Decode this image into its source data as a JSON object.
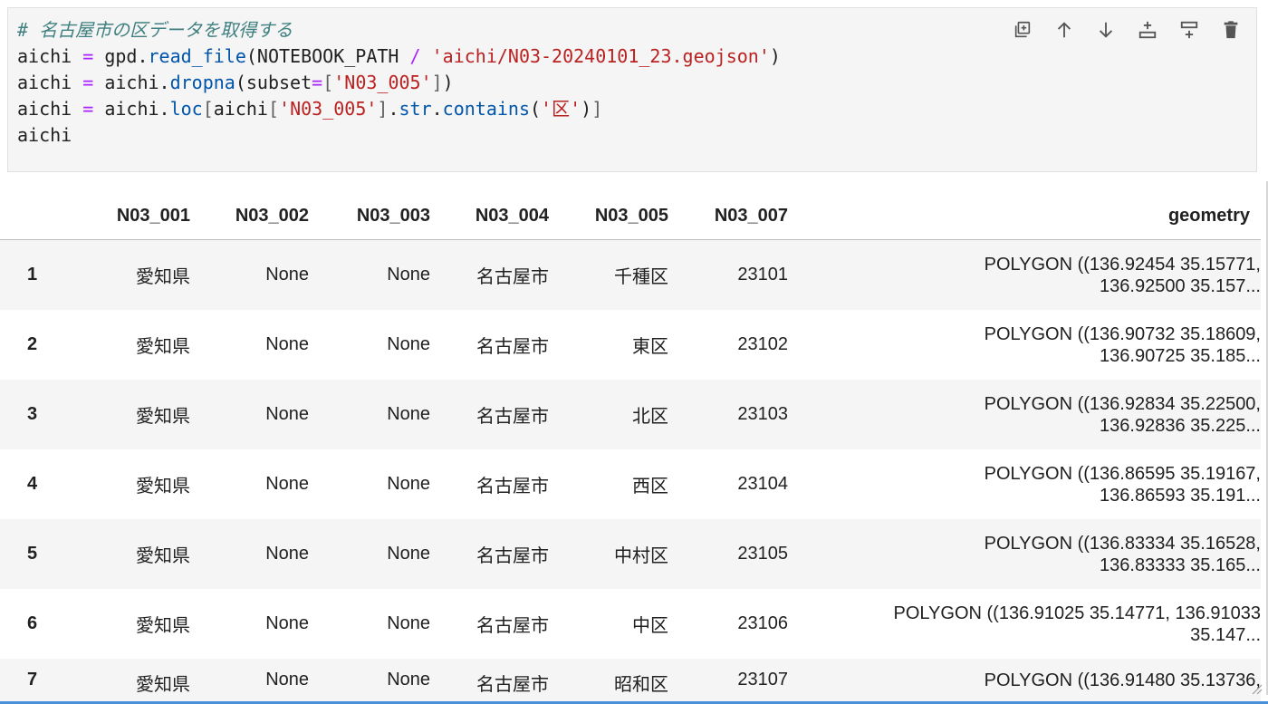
{
  "code_cell": {
    "lines": [
      [
        {
          "t": "# 名古屋市の区データを取得する",
          "c": "c-com"
        }
      ],
      [
        {
          "t": "aichi "
        },
        {
          "t": "=",
          "c": "c-op"
        },
        {
          "t": " gpd."
        },
        {
          "t": "read_file",
          "c": "c-fn"
        },
        {
          "t": "(NOTEBOOK_PATH "
        },
        {
          "t": "/",
          "c": "c-op"
        },
        {
          "t": " "
        },
        {
          "t": "'aichi/N03-20240101_23.geojson'",
          "c": "c-str"
        },
        {
          "t": ")"
        }
      ],
      [
        {
          "t": "aichi "
        },
        {
          "t": "=",
          "c": "c-op"
        },
        {
          "t": " aichi."
        },
        {
          "t": "dropna",
          "c": "c-fn"
        },
        {
          "t": "(subset"
        },
        {
          "t": "=",
          "c": "c-op"
        },
        {
          "t": "[",
          "c": "c-br"
        },
        {
          "t": "'N03_005'",
          "c": "c-str"
        },
        {
          "t": "]",
          "c": "c-br"
        },
        {
          "t": ")"
        }
      ],
      [
        {
          "t": "aichi "
        },
        {
          "t": "=",
          "c": "c-op"
        },
        {
          "t": " aichi."
        },
        {
          "t": "loc",
          "c": "c-fn"
        },
        {
          "t": "[",
          "c": "c-br"
        },
        {
          "t": "aichi"
        },
        {
          "t": "[",
          "c": "c-br"
        },
        {
          "t": "'N03_005'",
          "c": "c-str"
        },
        {
          "t": "]",
          "c": "c-br"
        },
        {
          "t": "."
        },
        {
          "t": "str",
          "c": "c-fn"
        },
        {
          "t": "."
        },
        {
          "t": "contains",
          "c": "c-fn"
        },
        {
          "t": "("
        },
        {
          "t": "'区'",
          "c": "c-str"
        },
        {
          "t": ")"
        },
        {
          "t": "]",
          "c": "c-br"
        }
      ],
      [
        {
          "t": "aichi"
        }
      ]
    ],
    "toolbar": [
      {
        "name": "duplicate-cell-icon",
        "label": "duplicate"
      },
      {
        "name": "move-up-icon",
        "label": "move up"
      },
      {
        "name": "move-down-icon",
        "label": "move down"
      },
      {
        "name": "insert-above-icon",
        "label": "insert above"
      },
      {
        "name": "insert-below-icon",
        "label": "insert below"
      },
      {
        "name": "delete-icon",
        "label": "delete"
      }
    ]
  },
  "table": {
    "columns": [
      "",
      "N03_001",
      "N03_002",
      "N03_003",
      "N03_004",
      "N03_005",
      "N03_007",
      "geometry"
    ],
    "rows": [
      {
        "index": "1",
        "N03_001": "愛知県",
        "N03_002": "None",
        "N03_003": "None",
        "N03_004": "名古屋市",
        "N03_005": "千種区",
        "N03_007": "23101",
        "geometry": [
          "POLYGON ((136.92454 35.15771,",
          "136.92500 35.157..."
        ]
      },
      {
        "index": "2",
        "N03_001": "愛知県",
        "N03_002": "None",
        "N03_003": "None",
        "N03_004": "名古屋市",
        "N03_005": "東区",
        "N03_007": "23102",
        "geometry": [
          "POLYGON ((136.90732 35.18609,",
          "136.90725 35.185..."
        ]
      },
      {
        "index": "3",
        "N03_001": "愛知県",
        "N03_002": "None",
        "N03_003": "None",
        "N03_004": "名古屋市",
        "N03_005": "北区",
        "N03_007": "23103",
        "geometry": [
          "POLYGON ((136.92834 35.22500,",
          "136.92836 35.225..."
        ]
      },
      {
        "index": "4",
        "N03_001": "愛知県",
        "N03_002": "None",
        "N03_003": "None",
        "N03_004": "名古屋市",
        "N03_005": "西区",
        "N03_007": "23104",
        "geometry": [
          "POLYGON ((136.86595 35.19167,",
          "136.86593 35.191..."
        ]
      },
      {
        "index": "5",
        "N03_001": "愛知県",
        "N03_002": "None",
        "N03_003": "None",
        "N03_004": "名古屋市",
        "N03_005": "中村区",
        "N03_007": "23105",
        "geometry": [
          "POLYGON ((136.83334 35.16528,",
          "136.83333 35.165..."
        ]
      },
      {
        "index": "6",
        "N03_001": "愛知県",
        "N03_002": "None",
        "N03_003": "None",
        "N03_004": "名古屋市",
        "N03_005": "中区",
        "N03_007": "23106",
        "geometry": [
          "POLYGON ((136.91025 35.14771, 136.91033",
          "35.147..."
        ]
      },
      {
        "index": "7",
        "N03_001": "愛知県",
        "N03_002": "None",
        "N03_003": "None",
        "N03_004": "名古屋市",
        "N03_005": "昭和区",
        "N03_007": "23107",
        "geometry": [
          "POLYGON ((136.91480 35.13736,",
          ""
        ]
      }
    ]
  }
}
